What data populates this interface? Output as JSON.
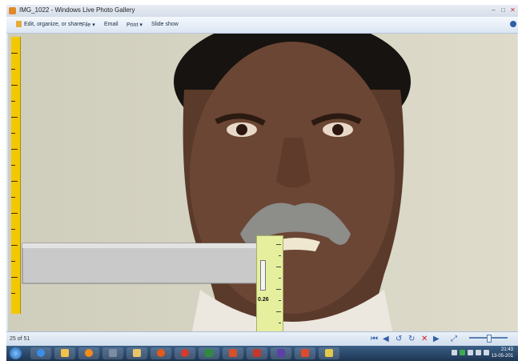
{
  "window": {
    "title": "IMG_1022 - Windows Live Photo Gallery",
    "controls": [
      "minimize-icon",
      "maximize-icon",
      "close-icon"
    ]
  },
  "menu": {
    "items": [
      {
        "label": "Edit, organize, or share",
        "icon": "edit-icon"
      },
      {
        "label": "File ▾"
      },
      {
        "label": "Email"
      },
      {
        "label": "Print ▾"
      },
      {
        "label": "Slide show"
      }
    ],
    "help_icon": "help-icon"
  },
  "photo": {
    "caliper_reading": "0.26",
    "ruler_color": "#f3c800",
    "caliper_color": "#e6ef9e"
  },
  "status": {
    "count": "25 of 51",
    "zoom_level": 0.5
  },
  "taskbar": {
    "apps": [
      "start-icon",
      "ie-icon",
      "explorer-icon",
      "media-player-icon",
      "network-icon",
      "folder-icon",
      "firefox-icon",
      "chrome-icon",
      "excel-icon",
      "powerpoint-icon",
      "app-icon",
      "app-icon",
      "photo-gallery-icon",
      "tools-icon"
    ],
    "clock_time": "21:43",
    "clock_date": "13-05-201"
  },
  "colors": {
    "taskbar": "#1d3553",
    "accent": "#2f5fa8"
  }
}
